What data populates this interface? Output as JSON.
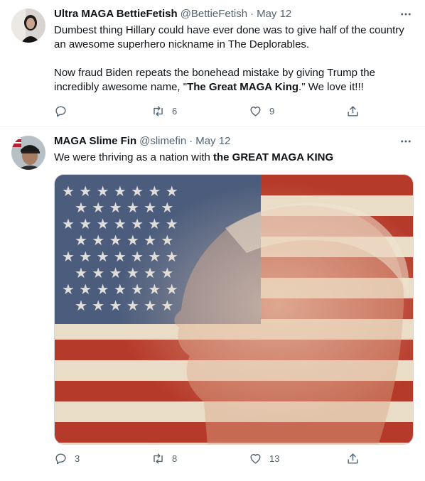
{
  "tweets": [
    {
      "name": "Ultra MAGA BettieFetish",
      "handle": "@BettieFetish",
      "sep": "·",
      "date": "May 12",
      "text_line1": "Dumbest thing Hillary could have ever done was to give half of the country an awesome superhero nickname in The Deplorables.",
      "text_p2_pre": "Now fraud Biden repeats the bonehead mistake by giving Trump the incredibly awesome name, \"",
      "text_p2_bold": "The Great MAGA King",
      "text_p2_post": ".\" We love it!!!",
      "replies": "",
      "retweets": "6",
      "likes": "9"
    },
    {
      "name": "MAGA Slime Fin",
      "handle": "@slimefin",
      "sep": "·",
      "date": "May 12",
      "text_pre": "We were thriving as a nation with ",
      "text_bold": "the GREAT MAGA KING",
      "replies": "3",
      "retweets": "8",
      "likes": "13"
    }
  ],
  "icons": {
    "more": "more-horizontal-icon",
    "reply": "reply-icon",
    "retweet": "retweet-icon",
    "like": "heart-icon",
    "share": "share-icon"
  },
  "colors": {
    "muted": "#536471",
    "text": "#0f1419",
    "divider": "#eff3f4"
  }
}
